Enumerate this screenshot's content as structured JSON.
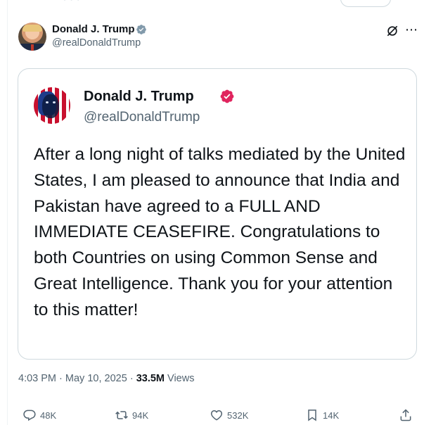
{
  "post": {
    "author_name": "Donald J. Trump",
    "author_handle": "@realDonaldTrump"
  },
  "quoted_post": {
    "author_name": "Donald J. Trump",
    "author_handle": "@realDonaldTrump",
    "text": "After a long night of talks mediated by the United States, I am pleased to announce that India and Pakistan have agreed to a FULL AND IMMEDIATE CEASEFIRE. Congratulations to both Countries on using Common Sense and Great Intelligence. Thank you for your attention to this matter!"
  },
  "meta": {
    "time": "4:03 PM",
    "separator": "·",
    "date": "May 10, 2025",
    "views_count": "33.5M",
    "views_label": "Views"
  },
  "actions": {
    "replies": "48K",
    "reposts": "94K",
    "likes": "532K",
    "bookmarks": "14K"
  },
  "icons": {
    "verified_gray": "verified-badge-gray",
    "verified_gold": "verified-badge-gold",
    "grok": "grok-icon",
    "more": "more-icon",
    "reply": "reply-icon",
    "repost": "repost-icon",
    "like": "heart-icon",
    "bookmark": "bookmark-icon",
    "share": "share-icon"
  },
  "colors": {
    "text": "#0f1419",
    "secondary": "#536471",
    "border": "#cfd9de",
    "verified_gold": "#e0245e",
    "verified_gray": "#829aab"
  }
}
